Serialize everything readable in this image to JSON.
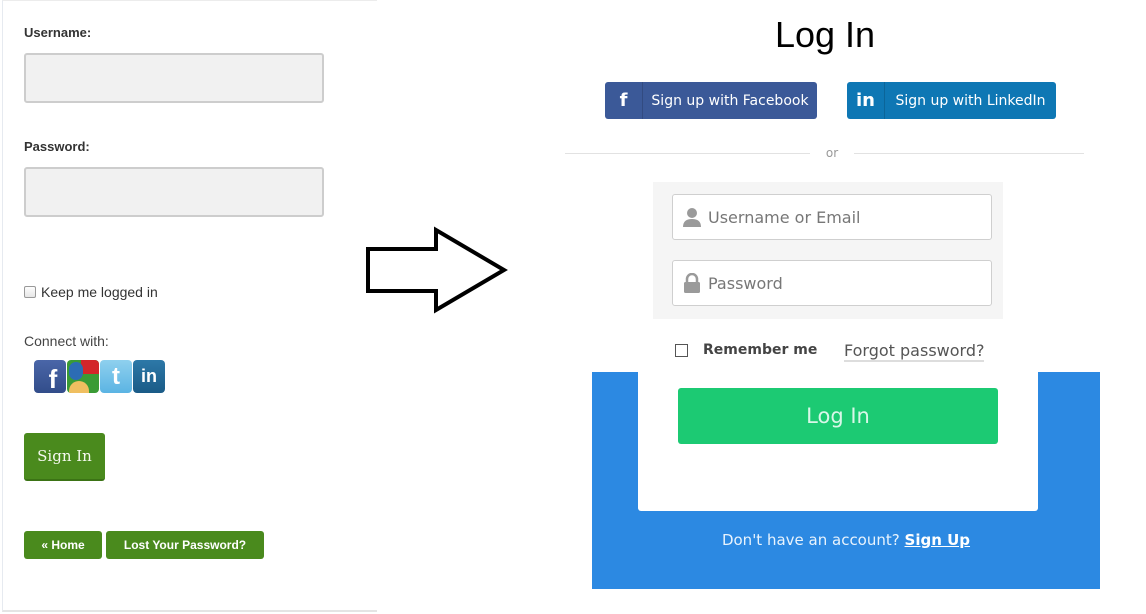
{
  "left_form": {
    "username_label": "Username:",
    "username_value": "",
    "password_label": "Password:",
    "password_value": "",
    "keep_logged_in_label": "Keep me logged in",
    "keep_logged_in_checked": false,
    "connect_with_label": "Connect with:",
    "social_icons": [
      {
        "name": "facebook-icon",
        "glyph": "f"
      },
      {
        "name": "google-icon",
        "glyph": ""
      },
      {
        "name": "twitter-icon",
        "glyph": "t"
      },
      {
        "name": "linkedin-icon",
        "glyph": "in"
      }
    ],
    "sign_in_label": "Sign In",
    "home_label": "« Home",
    "lost_password_label": "Lost Your Password?",
    "accent_color": "#4a8a1d"
  },
  "arrow": {
    "direction": "right"
  },
  "right_form": {
    "title": "Log In",
    "facebook_button": {
      "icon": "f",
      "label": "Sign up with Facebook",
      "color": "#3b5998"
    },
    "linkedin_button": {
      "icon": "in",
      "label": "Sign up with LinkedIn",
      "color": "#0e77b4"
    },
    "divider_text": "or",
    "username_placeholder": "Username or Email",
    "password_placeholder": "Password",
    "remember_label": "Remember me",
    "remember_checked": false,
    "forgot_label": "Forgot password?",
    "login_button_label": "Log In",
    "login_button_color": "#1cca73",
    "no_account_text": "Don't have an account?",
    "sign_up_label": "Sign Up",
    "background_color": "#2c89e2"
  }
}
